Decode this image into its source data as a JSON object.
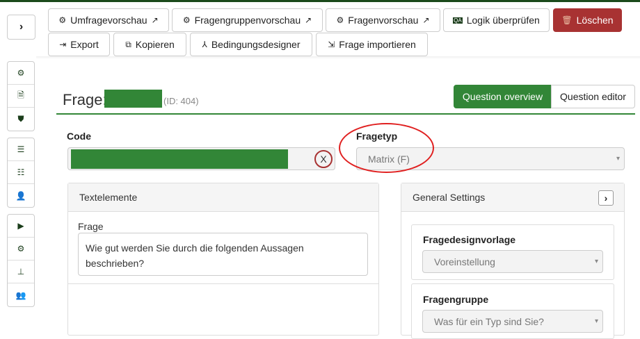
{
  "toolbar": {
    "row1": [
      "Umfragevorschau",
      "Fragengruppenvorschau",
      "Fragenvorschau",
      "Logik überprüfen",
      "Löschen"
    ],
    "row2": [
      "Export",
      "Kopieren",
      "Bedingungsdesigner",
      "Frage importieren"
    ]
  },
  "header": {
    "title": "Frage:",
    "id": "(ID: 404)",
    "tabs": [
      "Question overview",
      "Question editor"
    ]
  },
  "form": {
    "code_label": "Code",
    "clear": "X",
    "type_label": "Fragetyp",
    "type_value": "Matrix (F)"
  },
  "text_panel": {
    "title": "Textelemente",
    "question_label": "Frage",
    "question_text": "Wie gut werden Sie durch die folgenden Aussagen beschrieben?"
  },
  "settings": {
    "title": "General Settings",
    "template_label": "Fragedesignvorlage",
    "template_value": "Voreinstellung",
    "group_label": "Fragengruppe",
    "group_value": "Was für ein Typ sind Sie?"
  },
  "colors": {
    "accent": "#328637",
    "danger": "#a83232",
    "topbar": "#1b4a1b"
  }
}
